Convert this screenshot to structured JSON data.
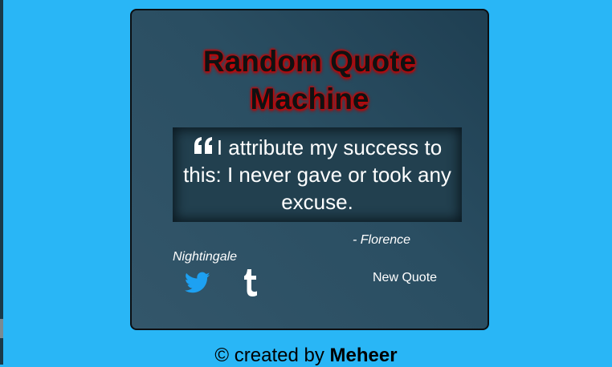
{
  "app": {
    "title_line1": "Random Quote",
    "title_line2": "Machine"
  },
  "quote": {
    "text": "I attribute my success to this: I never gave or took any excuse.",
    "author": "- Florence Nightingale"
  },
  "actions": {
    "new_quote_label": "New Quote"
  },
  "icons": {
    "quote": "quote-left-icon",
    "twitter": "twitter-icon",
    "tumblr": "tumblr-icon"
  },
  "colors": {
    "background": "#29b6f6",
    "card": "#2a4e62",
    "title_glow": "#d10000",
    "twitter": "#1da1f2"
  },
  "footer": {
    "prefix": "© created by",
    "author": "Meheer"
  }
}
